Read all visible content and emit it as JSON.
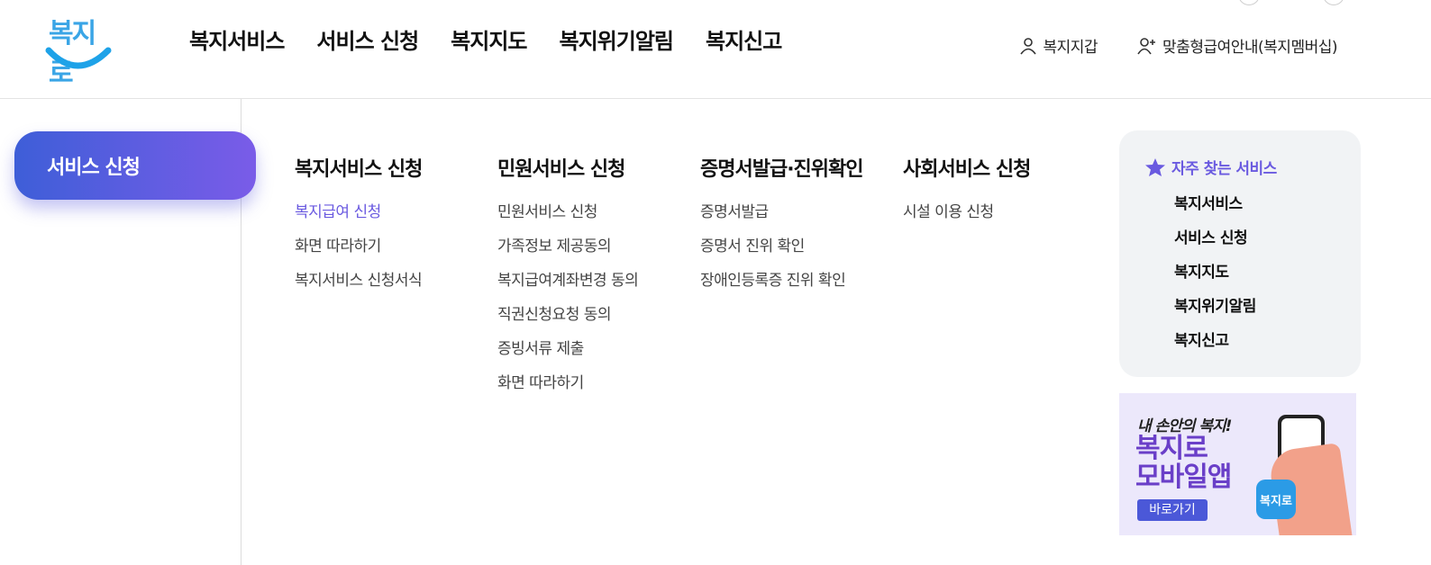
{
  "logo": {
    "text": "복지로"
  },
  "gnb": [
    "복지서비스",
    "서비스 신청",
    "복지지도",
    "복지위기알림",
    "복지신고"
  ],
  "util": {
    "wallet": "복지지갑",
    "membership": "맞춤형급여안내(복지멤버십)"
  },
  "left_menu": {
    "active": "서비스 신청"
  },
  "columns": [
    {
      "title": "복지서비스 신청",
      "links": [
        "복지급여 신청",
        "화면 따라하기",
        "복지서비스 신청서식"
      ]
    },
    {
      "title": "민원서비스 신청",
      "links": [
        "민원서비스 신청",
        "가족정보 제공동의",
        "복지급여계좌변경 동의",
        "직권신청요청 동의",
        "증빙서류 제출",
        "화면 따라하기"
      ]
    },
    {
      "title": "증명서발급·진위확인",
      "links": [
        "증명서발급",
        "증명서 진위 확인",
        "장애인등록증 진위 확인"
      ]
    },
    {
      "title": "사회서비스 신청",
      "links": [
        "시설 이용 신청"
      ]
    }
  ],
  "favorites": {
    "title": "자주 찾는 서비스",
    "links": [
      "복지서비스",
      "서비스 신청",
      "복지지도",
      "복지위기알림",
      "복지신고"
    ]
  },
  "banner": {
    "subtitle": "내 손안의 복지!",
    "line1": "복지로",
    "line2": "모바일앱",
    "button": "바로가기",
    "app_icon": "복지로"
  },
  "colors": {
    "accent": "#6a5ae0",
    "pill_start": "#3e5ed8",
    "pill_end": "#7a5ce8",
    "logo": "#3aa5e6"
  }
}
